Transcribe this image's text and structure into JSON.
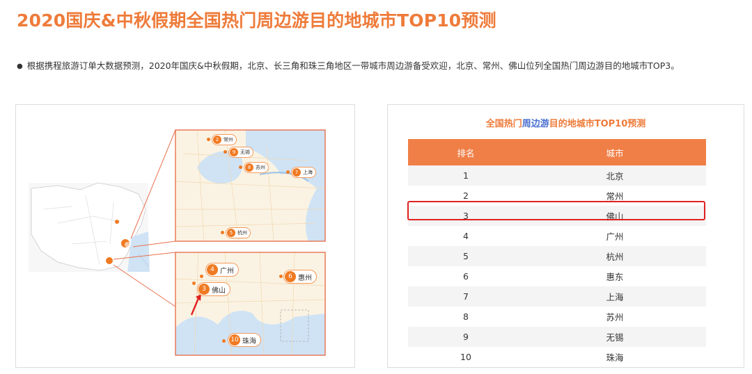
{
  "page": {
    "title": "2020国庆&中秋假期全国热门周边游目的地城市TOP10预测",
    "summary": "根据携程旅游订单大数据预测，2020年国庆&中秋假期，北京、长三角和珠三角地区一带城市周边游备受欢迎，北京、常州、佛山位列全国热门周边游目的地城市TOP3。"
  },
  "map": {
    "yangtze_pins": [
      {
        "rank": "2",
        "city": "常州"
      },
      {
        "rank": "9",
        "city": "无锡"
      },
      {
        "rank": "8",
        "city": "苏州"
      },
      {
        "rank": "7",
        "city": "上海"
      },
      {
        "rank": "5",
        "city": "杭州"
      }
    ],
    "pearl_pins": [
      {
        "rank": "4",
        "city": "广州"
      },
      {
        "rank": "3",
        "city": "佛山"
      },
      {
        "rank": "6",
        "city": "惠州"
      },
      {
        "rank": "10",
        "city": "珠海"
      }
    ],
    "colors": {
      "accent": "#f07a22",
      "frame": "#e8704e",
      "water": "#cfe3f5",
      "land": "#faf3e3"
    }
  },
  "table": {
    "title_part1": "全国热门",
    "title_part2": "周边游",
    "title_part3": "目的地城市TOP10预测",
    "headers": {
      "rank": "排名",
      "city": "城市"
    },
    "rows": [
      {
        "rank": "1",
        "city": "北京"
      },
      {
        "rank": "2",
        "city": "常州"
      },
      {
        "rank": "3",
        "city": "佛山"
      },
      {
        "rank": "4",
        "city": "广州"
      },
      {
        "rank": "5",
        "city": "杭州"
      },
      {
        "rank": "6",
        "city": "惠东"
      },
      {
        "rank": "7",
        "city": "上海"
      },
      {
        "rank": "8",
        "city": "苏州"
      },
      {
        "rank": "9",
        "city": "无锡"
      },
      {
        "rank": "10",
        "city": "珠海"
      }
    ],
    "highlighted_rank": "3",
    "colors": {
      "header_bg": "#f07f47",
      "highlight": "#e02020"
    }
  }
}
